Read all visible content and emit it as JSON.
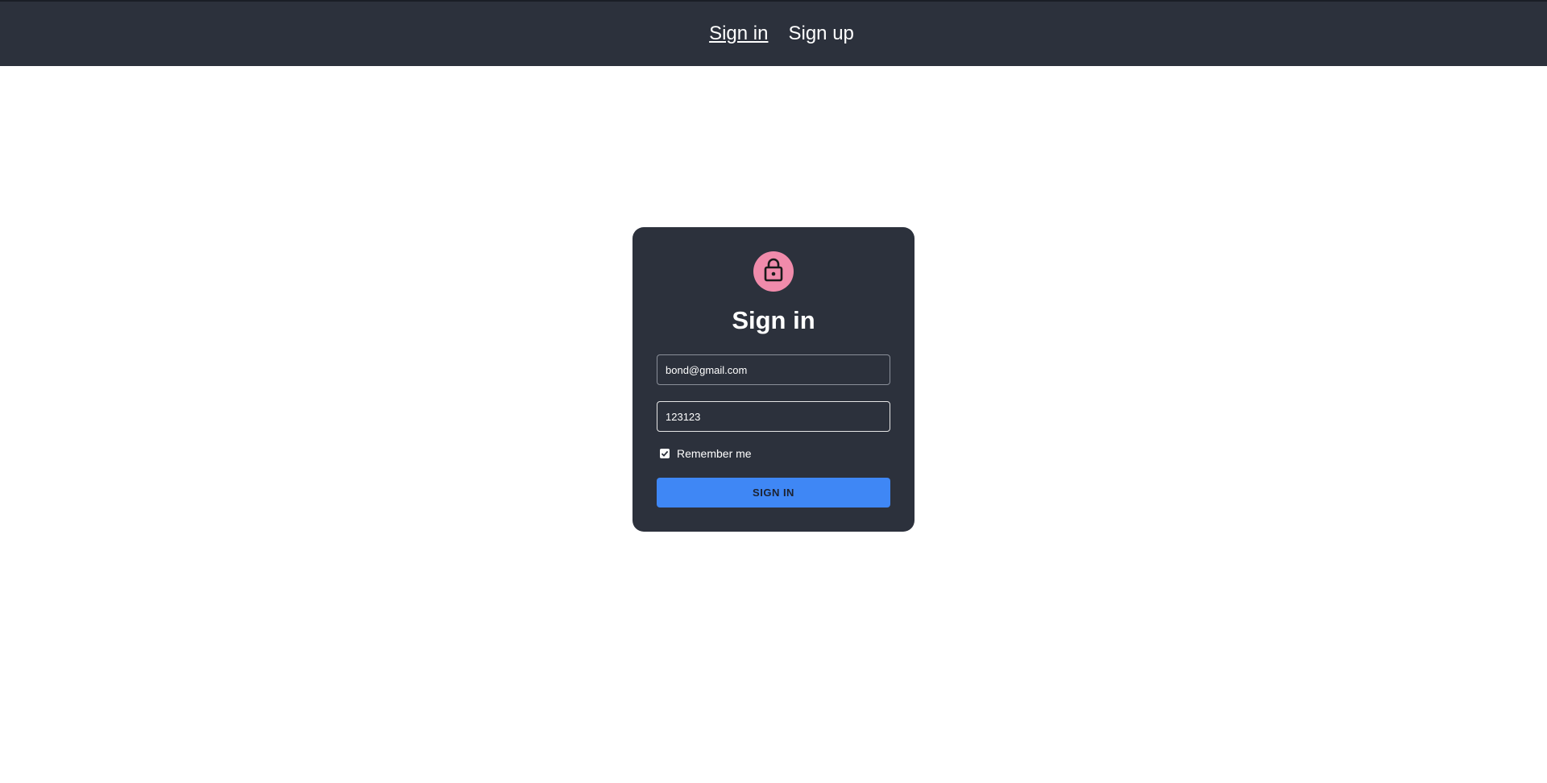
{
  "nav": {
    "signin_label": "Sign in",
    "signup_label": "Sign up"
  },
  "form": {
    "title": "Sign in",
    "icon": "lock-icon",
    "email_value": "bond@gmail.com",
    "password_value": "123123",
    "remember_label": "Remember me",
    "remember_checked": true,
    "submit_label": "SIGN IN"
  },
  "colors": {
    "header_bg": "#2c313c",
    "card_bg": "#2c313c",
    "avatar_bg": "#f08bab",
    "button_bg": "#3f87f5"
  }
}
